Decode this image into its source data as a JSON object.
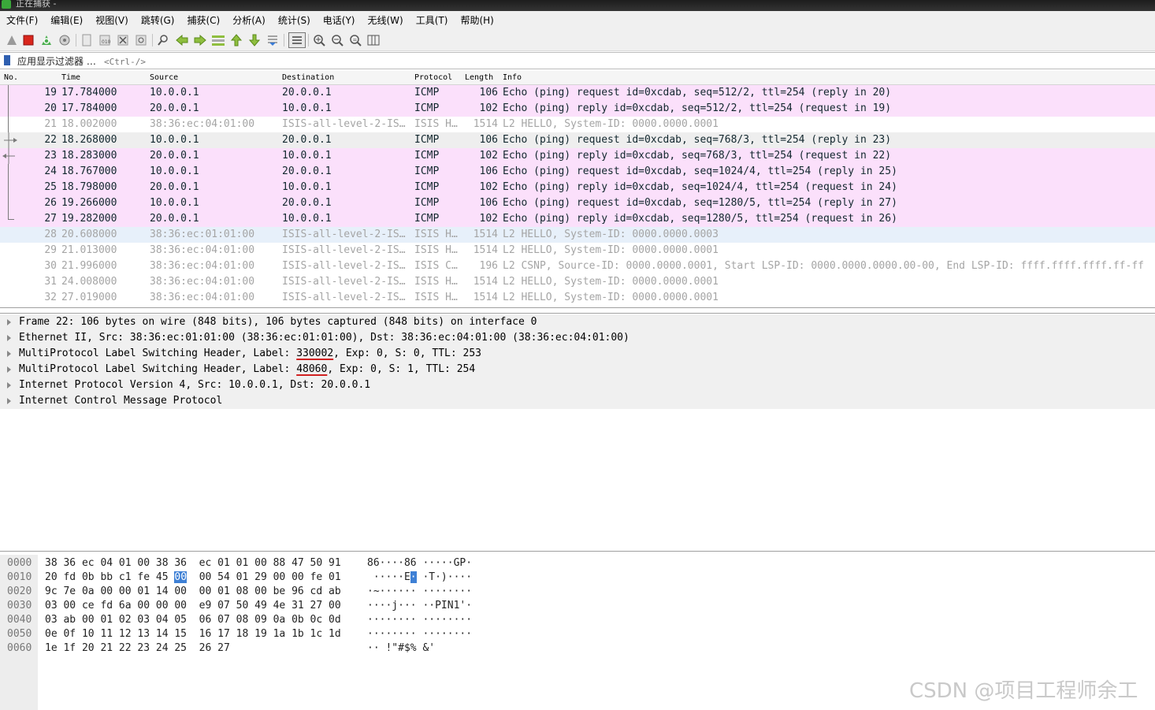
{
  "window": {
    "title": "正在捕获 -"
  },
  "menu": [
    {
      "name": "menu-file",
      "label": "文件(F)"
    },
    {
      "name": "menu-edit",
      "label": "编辑(E)"
    },
    {
      "name": "menu-view",
      "label": "视图(V)"
    },
    {
      "name": "menu-go",
      "label": "跳转(G)"
    },
    {
      "name": "menu-capture",
      "label": "捕获(C)"
    },
    {
      "name": "menu-analyze",
      "label": "分析(A)"
    },
    {
      "name": "menu-statistics",
      "label": "统计(S)"
    },
    {
      "name": "menu-telephony",
      "label": "电话(Y)"
    },
    {
      "name": "menu-wireless",
      "label": "无线(W)"
    },
    {
      "name": "menu-tools",
      "label": "工具(T)"
    },
    {
      "name": "menu-help",
      "label": "帮助(H)"
    }
  ],
  "toolbar": {
    "icons": [
      "start-capture-icon",
      "stop-capture-icon",
      "restart-capture-icon",
      "capture-options-icon",
      "open-file-icon",
      "save-file-icon",
      "close-file-icon",
      "reload-file-icon",
      "find-packet-icon",
      "go-back-icon",
      "go-forward-icon",
      "go-to-packet-icon",
      "go-first-icon",
      "go-last-icon",
      "auto-scroll-icon",
      "colorize-icon",
      "zoom-in-icon",
      "zoom-out-icon",
      "normal-size-icon",
      "resize-columns-icon"
    ],
    "accent_red": "#d9261c",
    "accent_green": "#3aa83a"
  },
  "filter": {
    "label": "应用显示过滤器 …",
    "placeholder": "<Ctrl-/>"
  },
  "packet_list": {
    "columns": [
      "No.",
      "Time",
      "Source",
      "Destination",
      "Protocol",
      "Length",
      "Info"
    ],
    "rows": [
      {
        "no": "19",
        "time": "17.784000",
        "src": "10.0.0.1",
        "dst": "20.0.0.1",
        "proto": "ICMP",
        "len": "106",
        "info": "Echo (ping) request  id=0xcdab, seq=512/2, ttl=254 (reply in 20)",
        "style": "icmp",
        "marker": "line"
      },
      {
        "no": "20",
        "time": "17.784000",
        "src": "20.0.0.1",
        "dst": "10.0.0.1",
        "proto": "ICMP",
        "len": "102",
        "info": "Echo (ping) reply    id=0xcdab, seq=512/2, ttl=254 (request in 19)",
        "style": "icmp",
        "marker": "line"
      },
      {
        "no": "21",
        "time": "18.002000",
        "src": "38:36:ec:04:01:00",
        "dst": "ISIS-all-level-2-IS…",
        "proto": "ISIS H…",
        "len": "1514",
        "info": "L2 HELLO, System-ID: 0000.0000.0001",
        "style": "isis",
        "marker": "line"
      },
      {
        "no": "22",
        "time": "18.268000",
        "src": "10.0.0.1",
        "dst": "20.0.0.1",
        "proto": "ICMP",
        "len": "106",
        "info": "Echo (ping) request  id=0xcdab, seq=768/3, ttl=254 (reply in 23)",
        "style": "sel",
        "marker": "request"
      },
      {
        "no": "23",
        "time": "18.283000",
        "src": "20.0.0.1",
        "dst": "10.0.0.1",
        "proto": "ICMP",
        "len": "102",
        "info": "Echo (ping) reply    id=0xcdab, seq=768/3, ttl=254 (request in 22)",
        "style": "icmp",
        "marker": "response"
      },
      {
        "no": "24",
        "time": "18.767000",
        "src": "10.0.0.1",
        "dst": "20.0.0.1",
        "proto": "ICMP",
        "len": "106",
        "info": "Echo (ping) request  id=0xcdab, seq=1024/4, ttl=254 (reply in 25)",
        "style": "icmp",
        "marker": "line"
      },
      {
        "no": "25",
        "time": "18.798000",
        "src": "20.0.0.1",
        "dst": "10.0.0.1",
        "proto": "ICMP",
        "len": "102",
        "info": "Echo (ping) reply    id=0xcdab, seq=1024/4, ttl=254 (request in 24)",
        "style": "icmp",
        "marker": "line"
      },
      {
        "no": "26",
        "time": "19.266000",
        "src": "10.0.0.1",
        "dst": "20.0.0.1",
        "proto": "ICMP",
        "len": "106",
        "info": "Echo (ping) request  id=0xcdab, seq=1280/5, ttl=254 (reply in 27)",
        "style": "icmp",
        "marker": "line"
      },
      {
        "no": "27",
        "time": "19.282000",
        "src": "20.0.0.1",
        "dst": "10.0.0.1",
        "proto": "ICMP",
        "len": "102",
        "info": "Echo (ping) reply    id=0xcdab, seq=1280/5, ttl=254 (request in 26)",
        "style": "icmp",
        "marker": "end"
      },
      {
        "no": "28",
        "time": "20.608000",
        "src": "38:36:ec:01:01:00",
        "dst": "ISIS-all-level-2-IS…",
        "proto": "ISIS H…",
        "len": "1514",
        "info": "L2 HELLO, System-ID: 0000.0000.0003",
        "style": "sel2",
        "marker": ""
      },
      {
        "no": "29",
        "time": "21.013000",
        "src": "38:36:ec:04:01:00",
        "dst": "ISIS-all-level-2-IS…",
        "proto": "ISIS H…",
        "len": "1514",
        "info": "L2 HELLO, System-ID: 0000.0000.0001",
        "style": "isis",
        "marker": ""
      },
      {
        "no": "30",
        "time": "21.996000",
        "src": "38:36:ec:04:01:00",
        "dst": "ISIS-all-level-2-IS…",
        "proto": "ISIS C…",
        "len": "196",
        "info": "L2 CSNP, Source-ID: 0000.0000.0001, Start LSP-ID: 0000.0000.0000.00-00, End LSP-ID: ffff.ffff.ffff.ff-ff",
        "style": "isis",
        "marker": ""
      },
      {
        "no": "31",
        "time": "24.008000",
        "src": "38:36:ec:04:01:00",
        "dst": "ISIS-all-level-2-IS…",
        "proto": "ISIS H…",
        "len": "1514",
        "info": "L2 HELLO, System-ID: 0000.0000.0001",
        "style": "isis",
        "marker": ""
      },
      {
        "no": "32",
        "time": "27.019000",
        "src": "38:36:ec:04:01:00",
        "dst": "ISIS-all-level-2-IS…",
        "proto": "ISIS H…",
        "len": "1514",
        "info": "L2 HELLO, System-ID: 0000.0000.0001",
        "style": "isis",
        "marker": ""
      }
    ],
    "colors": {
      "icmp": "#fbe0fb",
      "selected": "#eeeeee",
      "isis_text": "#a5a5a5"
    }
  },
  "details": {
    "frame": "Frame 22: 106 bytes on wire (848 bits), 106 bytes captured (848 bits) on interface 0",
    "ethernet": "Ethernet II, Src: 38:36:ec:01:01:00 (38:36:ec:01:01:00), Dst: 38:36:ec:04:01:00 (38:36:ec:04:01:00)",
    "mpls1_prefix": "MultiProtocol Label Switching Header, Label: ",
    "mpls1_label": "330002",
    "mpls1_suffix": ", Exp: 0, S: 0, TTL: 253",
    "mpls2_prefix": "MultiProtocol Label Switching Header, Label: ",
    "mpls2_label": "48060",
    "mpls2_suffix": ", Exp: 0, S: 1, TTL: 254",
    "ip": "Internet Protocol Version 4, Src: 10.0.0.1, Dst: 20.0.0.1",
    "icmp": "Internet Control Message Protocol"
  },
  "bytes": [
    {
      "off": "0000",
      "hex1": "38 36 ec 04 01 00 38 36",
      "hex2": "ec 01 01 00 88 47 50 91",
      "ascii": "86····86 ·····GP·"
    },
    {
      "off": "0010",
      "hex1": "20 fd 0b bb c1 fe 45 ",
      "hexsel": "00",
      "hex2": "00 54 01 29 00 00 fe 01",
      "ascii_pre": " ·····E",
      "ascii_sel": "·",
      "ascii_post": " ·T·)····"
    },
    {
      "off": "0020",
      "hex1": "9c 7e 0a 00 00 01 14 00",
      "hex2": "00 01 08 00 be 96 cd ab",
      "ascii": "·~······ ········"
    },
    {
      "off": "0030",
      "hex1": "03 00 ce fd 6a 00 00 00",
      "hex2": "e9 07 50 49 4e 31 27 00",
      "ascii": "····j··· ··PIN1'·"
    },
    {
      "off": "0040",
      "hex1": "03 ab 00 01 02 03 04 05",
      "hex2": "06 07 08 09 0a 0b 0c 0d",
      "ascii": "········ ········"
    },
    {
      "off": "0050",
      "hex1": "0e 0f 10 11 12 13 14 15",
      "hex2": "16 17 18 19 1a 1b 1c 1d",
      "ascii": "········ ········"
    },
    {
      "off": "0060",
      "hex1": "1e 1f 20 21 22 23 24 25",
      "hex2": "26 27",
      "ascii": "·· !\"#$% &'"
    }
  ],
  "watermark": "CSDN @项目工程师余工"
}
